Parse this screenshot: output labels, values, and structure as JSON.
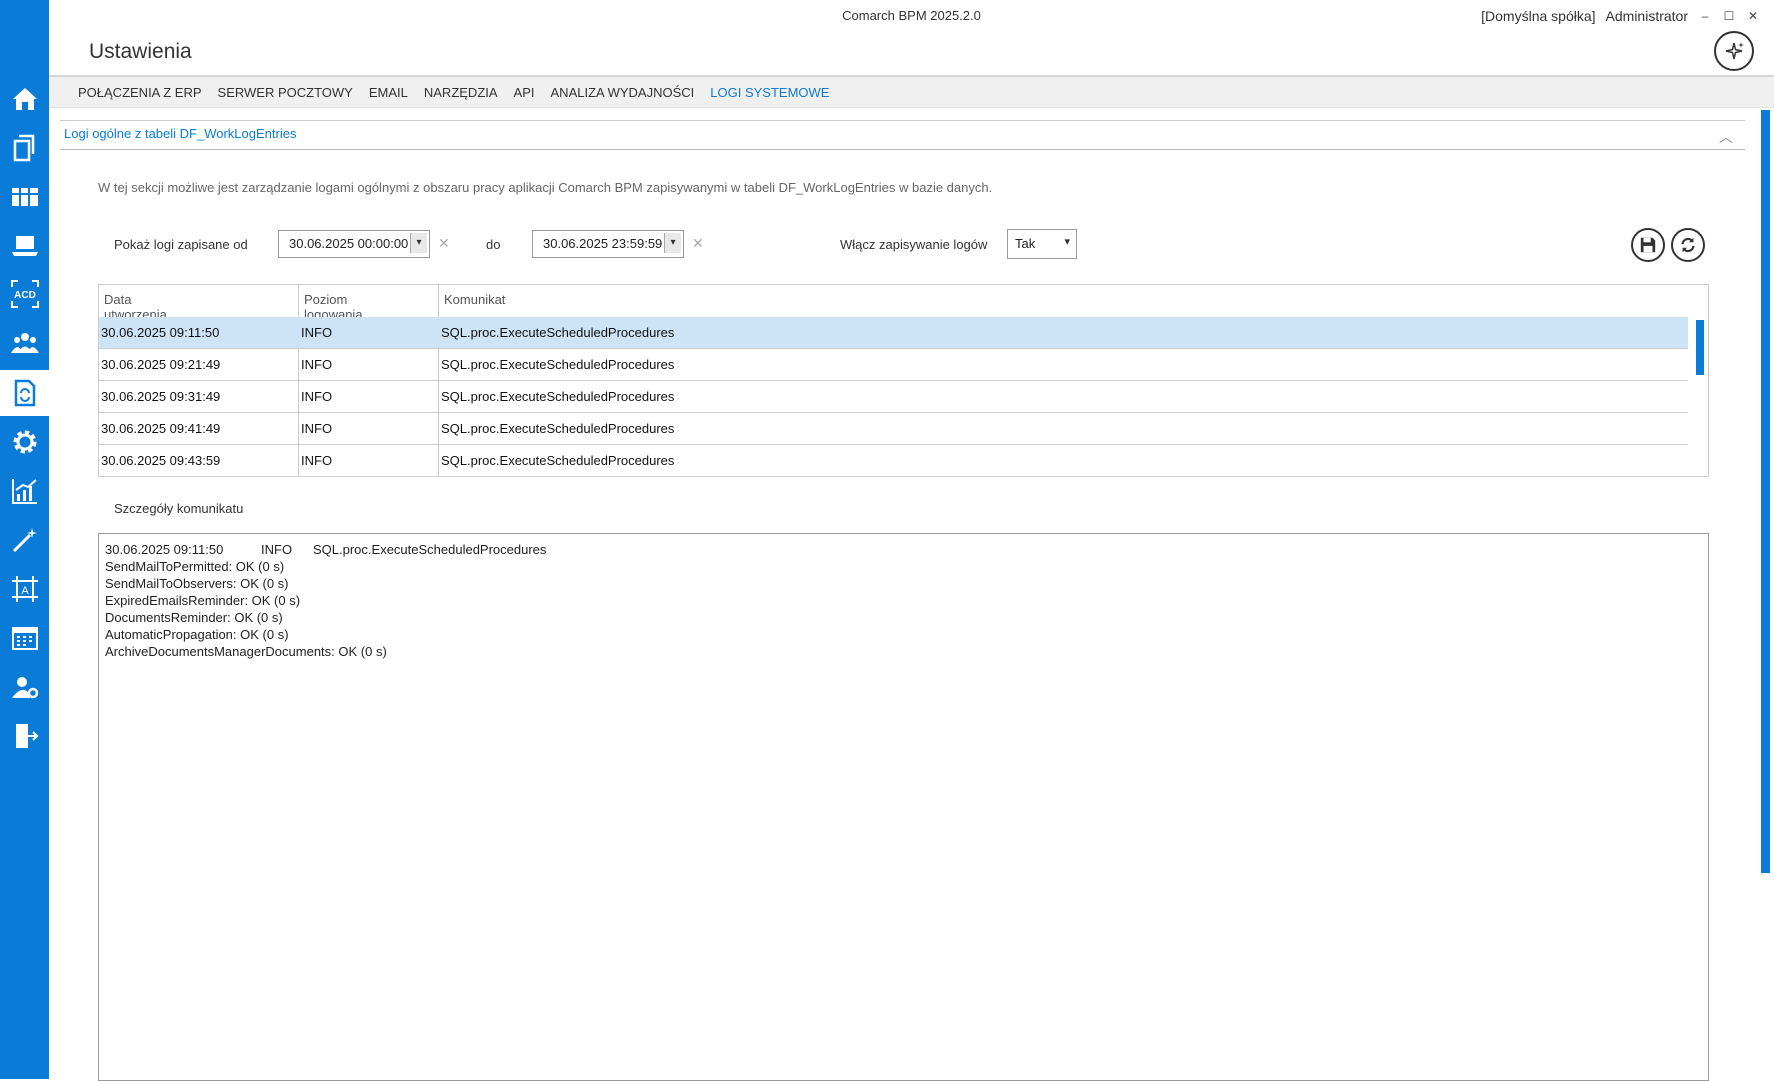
{
  "app_title": "Comarch BPM 2025.2.0",
  "company": "[Domyślna spółka]",
  "user": "Administrator",
  "window_buttons": [
    "‒",
    "☐",
    "✕"
  ],
  "page_title": "Ustawienia",
  "tabs": [
    {
      "label": "POŁĄCZENIA Z ERP",
      "active": false
    },
    {
      "label": "SERWER POCZTOWY",
      "active": false
    },
    {
      "label": "EMAIL",
      "active": false
    },
    {
      "label": "NARZĘDZIA",
      "active": false
    },
    {
      "label": "API",
      "active": false
    },
    {
      "label": "ANALIZA WYDAJNOŚCI",
      "active": false
    },
    {
      "label": "LOGI SYSTEMOWE",
      "active": true
    }
  ],
  "section": {
    "title": "Logi ogólne z tabeli DF_WorkLogEntries",
    "collapse_icon": "︿",
    "description": "W tej sekcji możliwe jest zarządzanie logami ogólnymi z obszaru pracy aplikacji Comarch BPM zapisywanymi w tabeli DF_WorkLogEntries w bazie danych."
  },
  "filters": {
    "from_label": "Pokaż logi zapisane od",
    "from_value": "30.06.2025 00:00:00",
    "to_label": "do",
    "to_value": "30.06.2025 23:59:59",
    "clear_glyph": "✕",
    "dropdown_glyph": "▾",
    "enable_label": "Włącz zapisywanie logów",
    "enable_value": "Tak"
  },
  "grid": {
    "columns": [
      "Data utworzenia",
      "Poziom logowania",
      "Komunikat"
    ],
    "rows": [
      {
        "date": "30.06.2025 09:11:50",
        "level": "INFO",
        "message": "SQL.proc.ExecuteScheduledProcedures",
        "selected": true
      },
      {
        "date": "30.06.2025 09:21:49",
        "level": "INFO",
        "message": "SQL.proc.ExecuteScheduledProcedures",
        "selected": false
      },
      {
        "date": "30.06.2025 09:31:49",
        "level": "INFO",
        "message": "SQL.proc.ExecuteScheduledProcedures",
        "selected": false
      },
      {
        "date": "30.06.2025 09:41:49",
        "level": "INFO",
        "message": "SQL.proc.ExecuteScheduledProcedures",
        "selected": false
      },
      {
        "date": "30.06.2025 09:43:59",
        "level": "INFO",
        "message": "SQL.proc.ExecuteScheduledProcedures",
        "selected": false
      }
    ]
  },
  "details": {
    "label": "Szczegóły komunikatu",
    "header_date": "30.06.2025 09:11:50",
    "header_level": "INFO",
    "header_message": "SQL.proc.ExecuteScheduledProcedures",
    "lines": [
      "SendMailToPermitted: OK (0 s)",
      "SendMailToObservers: OK (0 s)",
      "ExpiredEmailsReminder: OK (0 s)",
      "DocumentsReminder: OK (0 s)",
      "AutomaticPropagation: OK (0 s)",
      "ArchiveDocumentsManagerDocuments: OK (0 s)"
    ]
  },
  "sidebar_icons": [
    "home-icon",
    "documents-icon",
    "library-icon",
    "laptop-icon",
    "acd-icon",
    "users-icon",
    "document-refresh-icon",
    "gear-icon",
    "analytics-icon",
    "wand-icon",
    "design-icon",
    "calendar-icon",
    "user-settings-icon",
    "logout-icon"
  ],
  "sidebar_acd_text": "ACD",
  "sidebar_design_text": "A",
  "colors": {
    "accent": "#0a7bd6",
    "selected_row": "#cde4f7"
  }
}
